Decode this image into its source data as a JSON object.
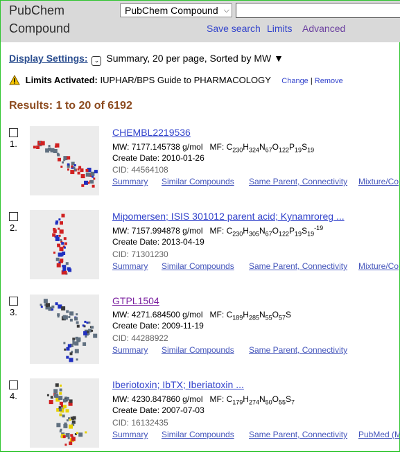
{
  "header": {
    "brand_line1": "PubChem",
    "brand_line2": "Compound",
    "database_select": "PubChem Compound",
    "search_value": "",
    "links": [
      "Save search",
      "Limits",
      "Advanced"
    ]
  },
  "display_settings": {
    "label": "Display Settings:",
    "value": "Summary, 20 per page, Sorted by MW ▼"
  },
  "limits": {
    "label": "Limits Activated:",
    "value": "IUPHAR/BPS Guide to PHARMACOLOGY",
    "change": "Change",
    "sep": "|",
    "remove": "Remove"
  },
  "results_text": "Results: 1 to 20 of 6192",
  "items": [
    {
      "num": "1.",
      "title": "CHEMBL2219536",
      "mw": "MW: 7177.145738 g/mol",
      "mf_label": "MF:",
      "mf": [
        [
          "C",
          "230"
        ],
        [
          "H",
          "324"
        ],
        [
          "N",
          "67"
        ],
        [
          "O",
          "122"
        ],
        [
          "P",
          "19"
        ],
        [
          "S",
          "19"
        ]
      ],
      "charge": "",
      "create_date": "Create Date: 2010-01-26",
      "cid": "CID: 44564108",
      "links": [
        "Summary",
        "Similar Compounds",
        "Same Parent, Connectivity",
        "Mixture/Co"
      ]
    },
    {
      "num": "2.",
      "title": "Mipomersen; ISIS 301012 parent acid; Kynamroreg ...",
      "mw": "MW: 7157.994878 g/mol",
      "mf_label": "MF:",
      "mf": [
        [
          "C",
          "230"
        ],
        [
          "H",
          "305"
        ],
        [
          "N",
          "67"
        ],
        [
          "O",
          "122"
        ],
        [
          "P",
          "19"
        ],
        [
          "S",
          "19"
        ]
      ],
      "charge": "-19",
      "create_date": "Create Date: 2013-04-19",
      "cid": "CID: 71301230",
      "links": [
        "Summary",
        "Similar Compounds",
        "Same Parent, Connectivity",
        "Mixture/Co"
      ]
    },
    {
      "num": "3.",
      "title": "GTPL1504",
      "mw": "MW: 4271.684500 g/mol",
      "mf_label": "MF:",
      "mf": [
        [
          "C",
          "189"
        ],
        [
          "H",
          "285"
        ],
        [
          "N",
          "55"
        ],
        [
          "O",
          "57"
        ],
        [
          "S",
          ""
        ]
      ],
      "charge": "",
      "create_date": "Create Date: 2009-11-19",
      "cid": "CID: 44288922",
      "links": [
        "Summary",
        "Similar Compounds",
        "Same Parent, Connectivity"
      ]
    },
    {
      "num": "4.",
      "title": "Iberiotoxin; IbTX; Iberiatoxin ...",
      "mw": "MW: 4230.847860 g/mol",
      "mf_label": "MF:",
      "mf": [
        [
          "C",
          "179"
        ],
        [
          "H",
          "274"
        ],
        [
          "N",
          "50"
        ],
        [
          "O",
          "55"
        ],
        [
          "S",
          "7"
        ]
      ],
      "charge": "",
      "create_date": "Create Date: 2007-07-03",
      "cid": "CID: 16132435",
      "links": [
        "Summary",
        "Similar Compounds",
        "Same Parent, Connectivity",
        "PubMed (M"
      ]
    }
  ]
}
